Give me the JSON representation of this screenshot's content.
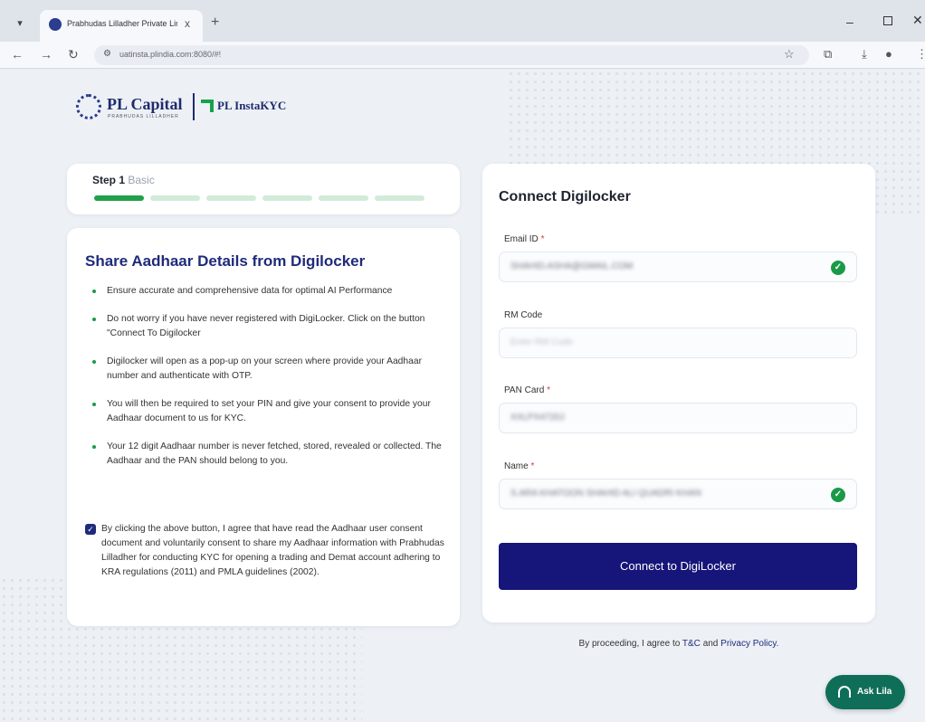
{
  "browser": {
    "tab_title": "Prabhudas Lilladher Private Lim",
    "url": "uatinsta.plindia.com:8080/#!",
    "tab_close": "x",
    "new_tab": "+"
  },
  "brand": {
    "name": "PL Capital",
    "sub": "PRABHUDAS LILLADHER",
    "product": "PL InstaKYC"
  },
  "progress": {
    "step_num": "Step 1",
    "step_name": "Basic",
    "total_steps": 6,
    "current_step": 1
  },
  "info": {
    "title": "Share Aadhaar Details from Digilocker",
    "bullets": [
      "Ensure accurate and comprehensive data for optimal AI Performance",
      "Do not worry if you have never registered with DigiLocker. Click on the button \"Connect To Digilocker",
      "Digilocker will open as a pop-up on your screen where provide your Aadhaar number and authenticate with OTP.",
      "You will then be required to set your PIN and give your consent to provide your Aadhaar document to us for KYC.",
      "Your 12 digit Aadhaar number is never fetched, stored, revealed or collected. The Aadhaar and the PAN should belong to you."
    ],
    "consent_checked": true,
    "consent": "By clicking the above button, I agree that have read the Aadhaar user consent document and voluntarily consent to share my Aadhaar information with Prabhudas Lilladher for conducting KYC for opening a trading and Demat account adhering to KRA regulations (2011) and PMLA guidelines (2002)."
  },
  "form": {
    "title": "Connect Digilocker",
    "email_label": "Email ID",
    "email_value": "SHAHID.ASHA@GMAIL.COM",
    "rm_label": "RM Code",
    "rm_placeholder": "Enter RM Code",
    "pan_label": "PAN Card",
    "pan_value": "XXLPX4720J",
    "name_label": "Name",
    "name_value": "S.ARA KHATOON SHAHID ALI QUADRI KHAN",
    "required_mark": "*",
    "button": "Connect to DigiLocker"
  },
  "legal": {
    "prefix": "By proceeding, I agree to",
    "tnc": "T&C",
    "and": "and",
    "privacy": "Privacy Policy."
  },
  "chat": {
    "label": "Ask Lila"
  },
  "colors": {
    "primary": "#15157a",
    "accent": "#1a9a48",
    "brand_text": "#1f2b7a"
  }
}
